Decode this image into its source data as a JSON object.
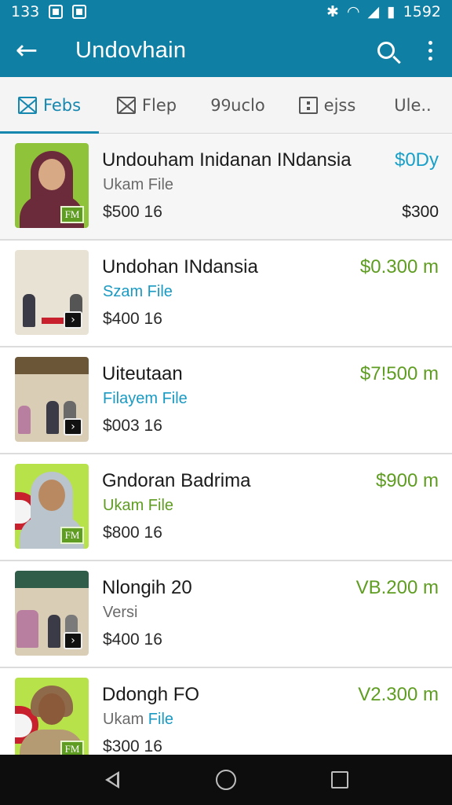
{
  "status_bar": {
    "time": "133",
    "battery": "1592"
  },
  "app_bar": {
    "title": "Undovhain",
    "back_icon": "back-arrow-icon",
    "search_icon": "search-icon",
    "more_icon": "more-vertical-icon"
  },
  "tabs": [
    {
      "label": "Febs",
      "icon": "image-icon",
      "active": true
    },
    {
      "label": "Flep",
      "icon": "image-icon",
      "active": false
    },
    {
      "label": "9Ꝯuclo",
      "icon": "",
      "active": false
    },
    {
      "label": "ejss",
      "icon": "dots-icon",
      "active": false
    },
    {
      "label": "Ule..",
      "icon": "",
      "active": false
    }
  ],
  "items": [
    {
      "title": "Undouham Inidanan INdansia",
      "subtitle": "Ukam File",
      "meta": "$500  16",
      "price": "$0Dy",
      "price2": "$300",
      "badge": "FM",
      "thumb": "portrait",
      "subtitle_color": "#6b6b6b",
      "price_color": "#1aa0c8"
    },
    {
      "title": "Undohan INdansia",
      "subtitle": "Szam File",
      "meta": "$400  16",
      "price": "$0.300  m",
      "price2": "",
      "badge": "play",
      "thumb": "scene",
      "subtitle_color": "#1a9ac2",
      "price_color": "#5f9d22"
    },
    {
      "title": "Uiteutaan",
      "subtitle": "Filayem File",
      "meta": "$003  16",
      "price": "$7!500  m",
      "price2": "",
      "badge": "play",
      "thumb": "scene",
      "subtitle_color": "#1a9ac2",
      "price_color": "#5f9d22"
    },
    {
      "title": "Gndoran Badrima",
      "subtitle": "Ukam File",
      "meta": "$800  16",
      "price": "$900  m",
      "price2": "",
      "badge": "FM",
      "thumb": "portrait-lime",
      "subtitle_color": "#5f9d22",
      "price_color": "#5f9d22"
    },
    {
      "title": "Nlongih 20",
      "subtitle": "Versi",
      "meta": "$400  16",
      "price": "VB.200  m",
      "price2": "",
      "badge": "play",
      "thumb": "scene",
      "subtitle_color": "#6b6b6b",
      "price_color": "#5f9d22"
    },
    {
      "title": "Ddongh FO",
      "subtitle": "Ukam File",
      "meta": "$300  16",
      "price": "V2.300  m",
      "price2": "",
      "badge": "FM",
      "thumb": "portrait-lime",
      "subtitle_color": "#1a9ac2",
      "price_color": "#5f9d22"
    }
  ],
  "nav_bar": {
    "back_icon": "nav-back-icon",
    "home_icon": "nav-home-icon",
    "recents_icon": "nav-recents-icon"
  },
  "colors": {
    "primary": "#0f7fa3",
    "accent": "#1688b0",
    "green": "#5f9d22"
  }
}
